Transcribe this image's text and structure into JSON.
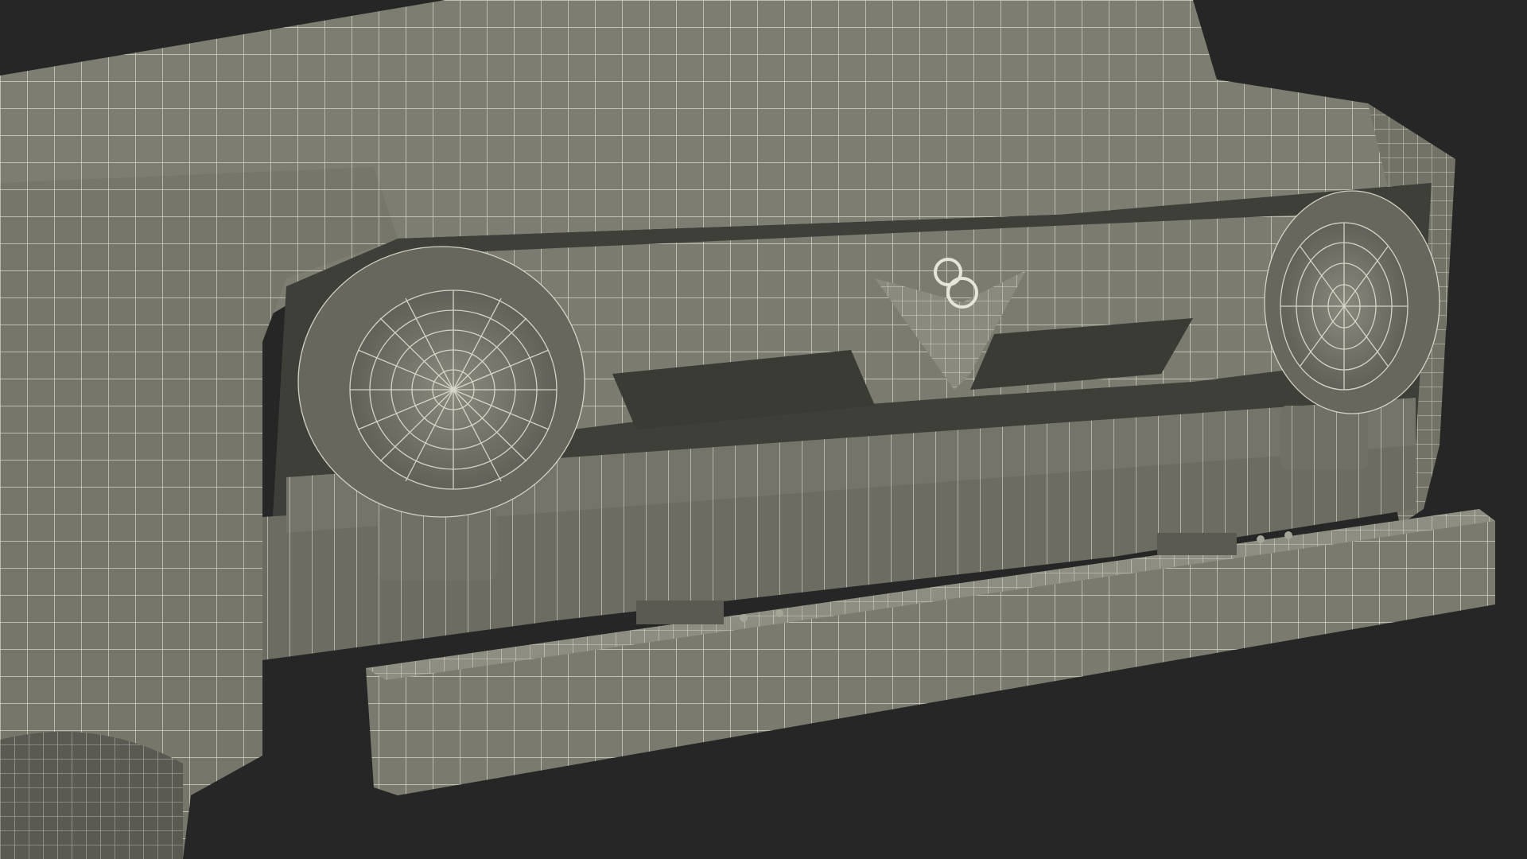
{
  "scene": {
    "subject": "3d-wireframe-truck-front",
    "background_color": "#262626",
    "surface_color": "#7d7d72",
    "shadow_color": "#3f3f39",
    "wire_color": "#e6e6d8",
    "emblem_glyph": "8"
  }
}
